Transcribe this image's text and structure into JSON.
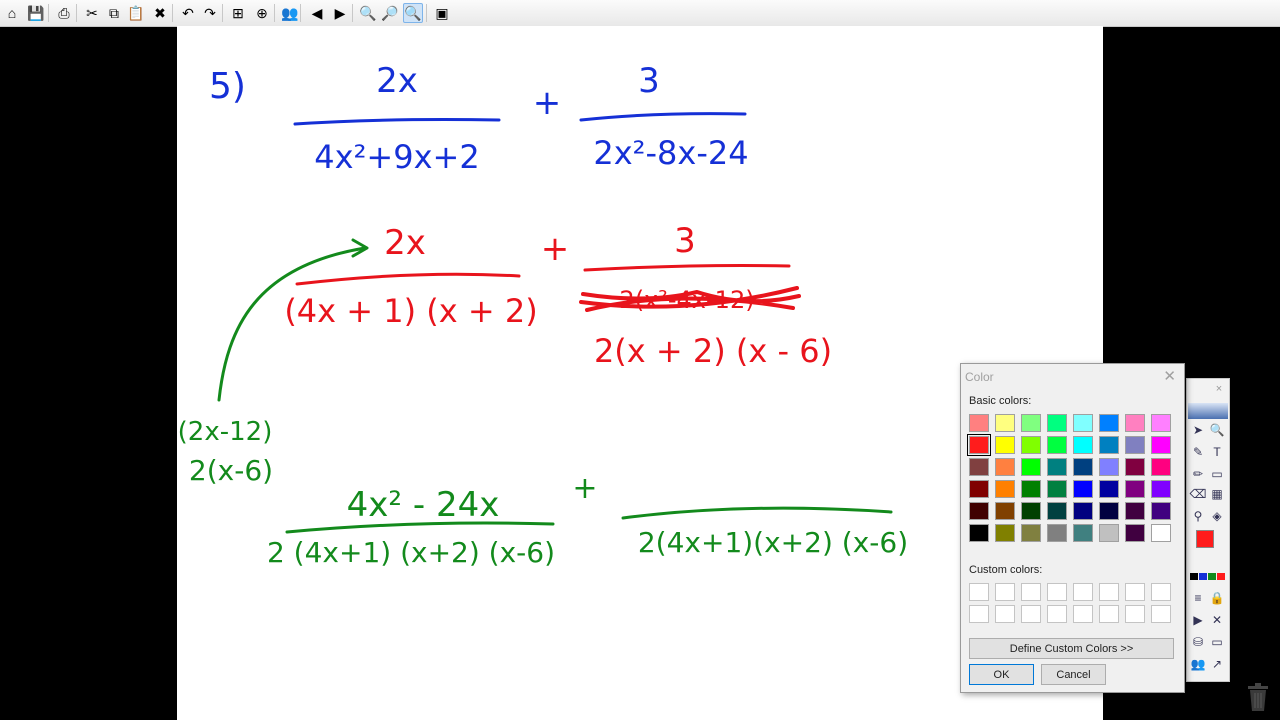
{
  "toolbar": {
    "buttons": [
      {
        "name": "open-icon",
        "glyph": "⌂"
      },
      {
        "name": "save-icon",
        "glyph": "💾"
      },
      {
        "name": "print-icon",
        "glyph": "⎙"
      },
      {
        "name": "cut-icon",
        "glyph": "✂"
      },
      {
        "name": "copy-icon",
        "glyph": "⧉"
      },
      {
        "name": "paste-icon",
        "glyph": "📋"
      },
      {
        "name": "delete-icon",
        "glyph": "✖"
      },
      {
        "name": "undo-icon",
        "glyph": "↶"
      },
      {
        "name": "redo-icon",
        "glyph": "↷"
      },
      {
        "name": "add-page-icon",
        "glyph": "⊞"
      },
      {
        "name": "duplicate-page-icon",
        "glyph": "⊕"
      },
      {
        "name": "users-icon",
        "glyph": "👥"
      },
      {
        "name": "previous-page-icon",
        "glyph": "◀"
      },
      {
        "name": "next-page-icon",
        "glyph": "▶"
      },
      {
        "name": "zoom-in-icon",
        "glyph": "🔍"
      },
      {
        "name": "zoom-out-icon",
        "glyph": "🔎"
      },
      {
        "name": "zoom-fit-icon",
        "glyph": "🔍"
      },
      {
        "name": "screen-icon",
        "glyph": "▣"
      }
    ]
  },
  "canvas": {
    "problem_number": "5)",
    "line1": {
      "num1": "2x",
      "den1": "4x²+9x+2",
      "op": "+",
      "num2": "3",
      "den2": "2x²-8x-24"
    },
    "line2": {
      "num1": "2x",
      "den1": "(4x + 1) (x + 2)",
      "op": "+",
      "num2": "3",
      "den2": "2(x + 2) (x - 6)",
      "crossed": "2(x²-4x-12)"
    },
    "side_note": {
      "line_a": "(2x-12)",
      "line_b": "2(x-6)"
    },
    "line3": {
      "num1": "4x² - 24x",
      "den1": "2 (4x+1) (x+2) (x-6)",
      "op": "+",
      "den2": "2(4x+1)(x+2) (x-6)"
    },
    "colors": {
      "blue": "#1530d6",
      "red": "#e8141c",
      "green": "#138a1c"
    }
  },
  "color_dialog": {
    "title": "Color",
    "basic_label": "Basic colors:",
    "custom_label": "Custom colors:",
    "define_button": "Define Custom Colors >>",
    "ok_button": "OK",
    "cancel_button": "Cancel",
    "selected_color": "#ff1c1c",
    "basic_colors": [
      "#ff8080",
      "#ffff80",
      "#80ff80",
      "#00ff80",
      "#80ffff",
      "#0080ff",
      "#ff80c0",
      "#ff80ff",
      "#ff1c1c",
      "#ffff00",
      "#80ff00",
      "#00ff40",
      "#00ffff",
      "#0080c0",
      "#8080c0",
      "#ff00ff",
      "#804040",
      "#ff8040",
      "#00ff00",
      "#008080",
      "#004080",
      "#8080ff",
      "#800040",
      "#ff0080",
      "#800000",
      "#ff8000",
      "#008000",
      "#008040",
      "#0000ff",
      "#0000a0",
      "#800080",
      "#8000ff",
      "#400000",
      "#804000",
      "#004000",
      "#004040",
      "#000080",
      "#000040",
      "#400040",
      "#400080",
      "#000000",
      "#808000",
      "#808040",
      "#808080",
      "#408080",
      "#c0c0c0",
      "#400040",
      "#ffffff"
    ]
  },
  "side_toolbar": {
    "close_glyph": "×",
    "icons": [
      {
        "name": "select-arrow-icon",
        "glyph": "➤"
      },
      {
        "name": "zoom-tool-icon",
        "glyph": "🔍"
      },
      {
        "name": "pen-tool-icon",
        "glyph": "✎"
      },
      {
        "name": "text-tool-icon",
        "glyph": "T"
      },
      {
        "name": "highlighter-icon",
        "glyph": "✏"
      },
      {
        "name": "shape-tool-icon",
        "glyph": "▭"
      },
      {
        "name": "eraser-icon",
        "glyph": "⌫"
      },
      {
        "name": "image-tool-icon",
        "glyph": "▦"
      },
      {
        "name": "eyedropper-icon",
        "glyph": "⚲"
      },
      {
        "name": "fill-icon",
        "glyph": "◈"
      },
      {
        "name": "line-style-icon",
        "glyph": "≡"
      },
      {
        "name": "lock-icon",
        "glyph": "🔒"
      },
      {
        "name": "media-icon",
        "glyph": "▶"
      },
      {
        "name": "tools-icon",
        "glyph": "✕"
      },
      {
        "name": "database-icon",
        "glyph": "⛁"
      },
      {
        "name": "display-icon",
        "glyph": "▭"
      },
      {
        "name": "people-icon",
        "glyph": "👥"
      },
      {
        "name": "export-icon",
        "glyph": "↗"
      }
    ],
    "mini_colors": [
      "#000000",
      "#1530d6",
      "#138a1c",
      "#ff1c1c"
    ]
  }
}
